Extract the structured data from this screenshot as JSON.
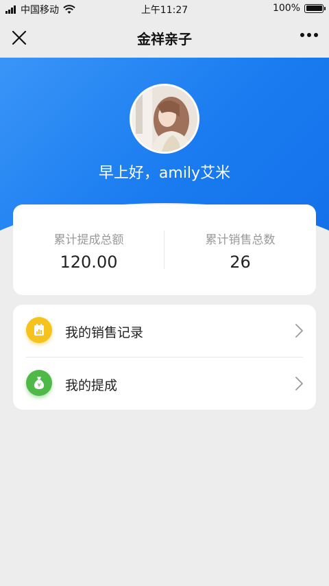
{
  "status_bar": {
    "carrier": "中国移动",
    "time": "上午11:27",
    "battery": "100%",
    "icons": [
      "signal-icon",
      "wifi-icon",
      "battery-icon"
    ]
  },
  "nav": {
    "title": "金祥亲子",
    "icons": [
      "close-icon",
      "more-icon"
    ]
  },
  "hero": {
    "greeting": "早上好，amily艾米",
    "colors": {
      "gradient_start": "#3a95f7",
      "gradient_end": "#1470ea"
    }
  },
  "stats": {
    "commission_total": {
      "label": "累计提成总额",
      "value": "120.00"
    },
    "sales_total": {
      "label": "累计销售总数",
      "value": "26"
    }
  },
  "menu": {
    "items": [
      {
        "label": "我的销售记录",
        "icon": "sales-record-icon",
        "icon_color": "#f6c21c"
      },
      {
        "label": "我的提成",
        "icon": "money-bag-icon",
        "icon_color": "#4fb947"
      }
    ]
  }
}
